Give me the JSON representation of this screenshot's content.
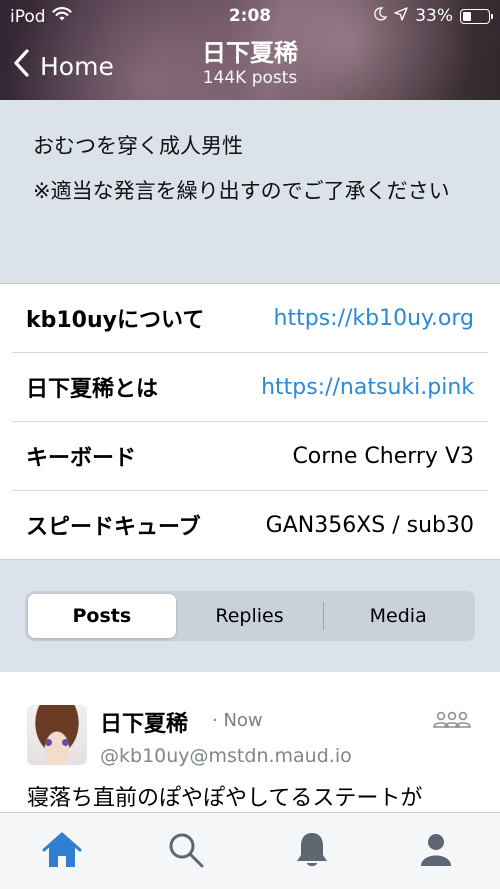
{
  "status_bar": {
    "carrier": "iPod",
    "time": "2:08",
    "battery": "33%",
    "battery_level": 0.33
  },
  "header": {
    "back_label": "Home",
    "profile_name": "日下夏稀",
    "post_count": "144K posts"
  },
  "bio": {
    "lines": [
      "おむつを穿く成人男性",
      "※適当な発言を繰り出すのでご了承ください"
    ]
  },
  "fields": [
    {
      "name": "kb10uyについて",
      "value": "https://kb10uy.org",
      "is_link": true
    },
    {
      "name": "日下夏稀とは",
      "value": "https://natsuki.pink",
      "is_link": true
    },
    {
      "name": "キーボード",
      "value": "Corne Cherry V3",
      "is_link": false
    },
    {
      "name": "スピードキューブ",
      "value": "GAN356XS / sub30",
      "is_link": false
    }
  ],
  "tabs": {
    "posts": "Posts",
    "replies": "Replies",
    "media": "Media",
    "selected": "Posts"
  },
  "post": {
    "author": "日下夏稀",
    "time": "· Now",
    "handle": "@kb10uy@mstdn.maud.io",
    "text": "寝落ち直前のぽやぽやしてるステートが"
  },
  "colors": {
    "link": "#2b8ad6",
    "tab_active": "#2f7fd0",
    "tab_inactive": "#5e6671"
  },
  "icons": {
    "wifi": "wifi-icon",
    "moon": "moon-icon",
    "location": "location-arrow-icon",
    "battery": "battery-icon",
    "back": "chevron-left-icon",
    "group": "group-icon",
    "home": "home-icon",
    "search": "search-icon",
    "bell": "bell-icon",
    "profile": "profile-icon"
  }
}
